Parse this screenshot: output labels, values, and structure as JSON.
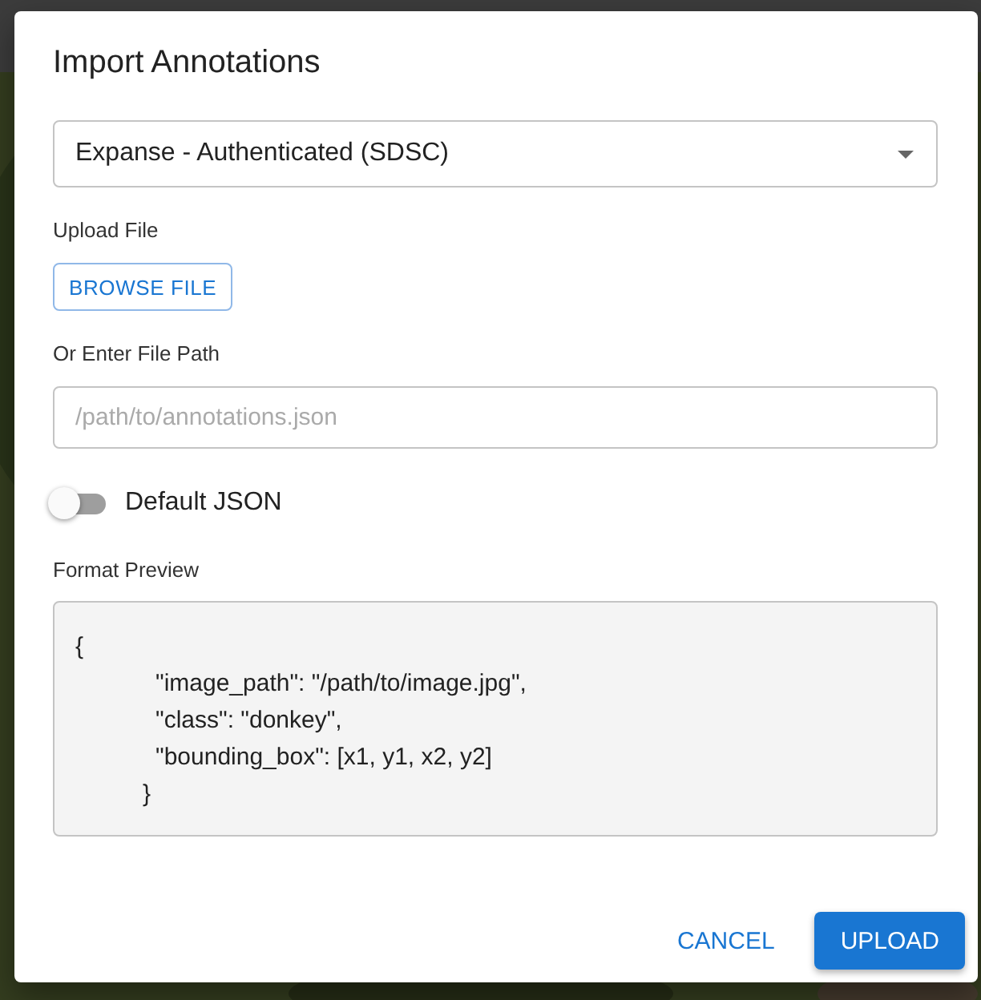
{
  "dialog": {
    "title": "Import Annotations"
  },
  "source_select": {
    "value": "Expanse - Authenticated (SDSC)"
  },
  "upload": {
    "label": "Upload File",
    "button": "BROWSE FILE"
  },
  "path": {
    "label": "Or Enter File Path",
    "placeholder": "/path/to/annotations.json"
  },
  "default_json": {
    "label": "Default JSON",
    "on": false
  },
  "preview": {
    "label": "Format Preview",
    "lines": [
      {
        "kind": "open",
        "text": "{"
      },
      {
        "kind": "entry",
        "text": "\"image_path\": \"/path/to/image.jpg\","
      },
      {
        "kind": "entry",
        "text": "\"class\": \"donkey\","
      },
      {
        "kind": "entry",
        "text": "\"bounding_box\": [x1, y1, x2, y2]"
      },
      {
        "kind": "close",
        "text": "}"
      }
    ]
  },
  "actions": [
    {
      "kind": "text",
      "label": "CANCEL"
    },
    {
      "kind": "contained",
      "label": "UPLOAD"
    }
  ]
}
